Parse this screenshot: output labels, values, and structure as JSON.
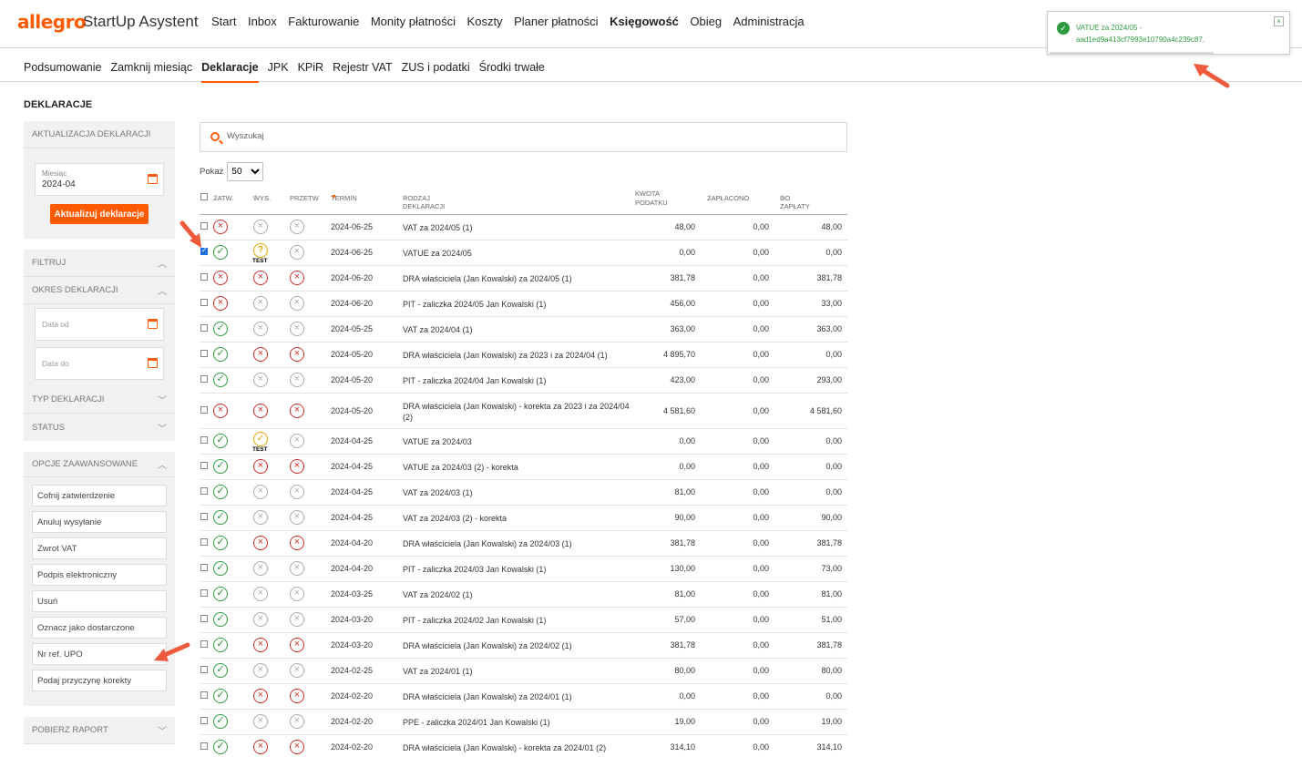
{
  "app": {
    "logo": "allegro",
    "name": "StartUp Asystent"
  },
  "topnav": [
    "Start",
    "Inbox",
    "Fakturowanie",
    "Monity płatności",
    "Koszty",
    "Planer płatności",
    "Księgowość",
    "Obieg",
    "Administracja"
  ],
  "topnav_active": "Księgowość",
  "subnav": [
    "Podsumowanie",
    "Zamknij miesiąc",
    "Deklaracje",
    "JPK",
    "KPiR",
    "Rejestr VAT",
    "ZUS i podatki",
    "Środki trwałe"
  ],
  "subnav_active": "Deklaracje",
  "page_title": "DEKLARACJE",
  "sidebar": {
    "update_panel": {
      "title": "AKTUALIZACJA DEKLARACJI",
      "month_label": "Miesiąc",
      "month_value": "2024-04",
      "button": "Aktualizuj deklaracje"
    },
    "filter": {
      "title": "FILTRUJ",
      "period_title": "OKRES DEKLARACJI",
      "date_from_placeholder": "Data od",
      "date_to_placeholder": "Data do",
      "type_title": "TYP DEKLARACJI",
      "status_title": "STATUS"
    },
    "advanced": {
      "title": "OPCJE ZAAWANSOWANE",
      "options": [
        "Cofnij zatwierdzenie",
        "Anuluj wysyłanie",
        "Zwrot VAT",
        "Podpis elektroniczny",
        "Usuń",
        "Oznacz jako dostarczone",
        "Nr ref. UPO",
        "Podaj przyczynę korekty"
      ]
    },
    "report": {
      "title": "POBIERZ RAPORT"
    }
  },
  "search": {
    "placeholder": "Wyszukaj"
  },
  "show": {
    "label": "Pokaż",
    "value": "50"
  },
  "table": {
    "headers": {
      "zatw": "ZATW.",
      "wys": "WYS.",
      "przetw": "PRZETW",
      "termin": "TERMIN",
      "rodzaj": "RODZAJ DEKLARACJI",
      "kwota": "KWOTA PODATKU",
      "zaplacono": "ZAPŁACONO",
      "do_zaplaty": "DO ZAPŁATY"
    },
    "test_label": "TEST",
    "rows": [
      {
        "checked": false,
        "zatw": "err",
        "wys": "na",
        "przetw": "na",
        "termin": "2024-06-25",
        "rodzaj": "VAT za 2024/05 (1)",
        "kwota": "48,00",
        "zaplacono": "0,00",
        "do_zaplaty": "48,00"
      },
      {
        "checked": true,
        "zatw": "ok",
        "wys": "test",
        "przetw": "na",
        "termin": "2024-06-25",
        "rodzaj": "VATUE za 2024/05",
        "kwota": "0,00",
        "zaplacono": "0,00",
        "do_zaplaty": "0,00"
      },
      {
        "checked": false,
        "zatw": "err",
        "wys": "err",
        "przetw": "err",
        "termin": "2024-06-20",
        "rodzaj": "DRA właściciela (Jan Kowalski) za 2024/05 (1)",
        "kwota": "381,78",
        "zaplacono": "0,00",
        "do_zaplaty": "381,78"
      },
      {
        "checked": false,
        "zatw": "err",
        "wys": "na",
        "przetw": "na",
        "termin": "2024-06-20",
        "rodzaj": "PIT - zaliczka 2024/05 Jan Kowalski (1)",
        "kwota": "456,00",
        "zaplacono": "0,00",
        "do_zaplaty": "33,00"
      },
      {
        "checked": false,
        "zatw": "ok",
        "wys": "na",
        "przetw": "na",
        "termin": "2024-05-25",
        "rodzaj": "VAT za 2024/04 (1)",
        "kwota": "363,00",
        "zaplacono": "0,00",
        "do_zaplaty": "363,00"
      },
      {
        "checked": false,
        "zatw": "ok",
        "wys": "err",
        "przetw": "err",
        "termin": "2024-05-20",
        "rodzaj": "DRA właściciela (Jan Kowalski) za 2023 i za 2024/04 (1)",
        "kwota": "4 895,70",
        "zaplacono": "0,00",
        "do_zaplaty": "0,00"
      },
      {
        "checked": false,
        "zatw": "ok",
        "wys": "na",
        "przetw": "na",
        "termin": "2024-05-20",
        "rodzaj": "PIT - zaliczka 2024/04 Jan Kowalski (1)",
        "kwota": "423,00",
        "zaplacono": "0,00",
        "do_zaplaty": "293,00"
      },
      {
        "checked": false,
        "zatw": "err",
        "wys": "err",
        "przetw": "err",
        "termin": "2024-05-20",
        "rodzaj": "DRA właściciela (Jan Kowalski) - korekta za 2023 i za 2024/04 (2)",
        "kwota": "4 581,60",
        "zaplacono": "0,00",
        "do_zaplaty": "4 581,60",
        "tall": true
      },
      {
        "checked": false,
        "zatw": "ok",
        "wys": "testok",
        "przetw": "na",
        "termin": "2024-04-25",
        "rodzaj": "VATUE za 2024/03",
        "kwota": "0,00",
        "zaplacono": "0,00",
        "do_zaplaty": "0,00"
      },
      {
        "checked": false,
        "zatw": "ok",
        "wys": "err",
        "przetw": "err",
        "termin": "2024-04-25",
        "rodzaj": "VATUE za 2024/03 (2) - korekta",
        "kwota": "0,00",
        "zaplacono": "0,00",
        "do_zaplaty": "0,00"
      },
      {
        "checked": false,
        "zatw": "ok",
        "wys": "na",
        "przetw": "na",
        "termin": "2024-04-25",
        "rodzaj": "VAT za 2024/03 (1)",
        "kwota": "81,00",
        "zaplacono": "0,00",
        "do_zaplaty": "0,00"
      },
      {
        "checked": false,
        "zatw": "ok",
        "wys": "na",
        "przetw": "na",
        "termin": "2024-04-25",
        "rodzaj": "VAT za 2024/03 (2) - korekta",
        "kwota": "90,00",
        "zaplacono": "0,00",
        "do_zaplaty": "90,00"
      },
      {
        "checked": false,
        "zatw": "ok",
        "wys": "err",
        "przetw": "err",
        "termin": "2024-04-20",
        "rodzaj": "DRA właściciela (Jan Kowalski) za 2024/03 (1)",
        "kwota": "381,78",
        "zaplacono": "0,00",
        "do_zaplaty": "381,78"
      },
      {
        "checked": false,
        "zatw": "ok",
        "wys": "na",
        "przetw": "na",
        "termin": "2024-04-20",
        "rodzaj": "PIT - zaliczka 2024/03 Jan Kowalski (1)",
        "kwota": "130,00",
        "zaplacono": "0,00",
        "do_zaplaty": "73,00"
      },
      {
        "checked": false,
        "zatw": "ok",
        "wys": "na",
        "przetw": "na",
        "termin": "2024-03-25",
        "rodzaj": "VAT za 2024/02 (1)",
        "kwota": "81,00",
        "zaplacono": "0,00",
        "do_zaplaty": "81,00"
      },
      {
        "checked": false,
        "zatw": "ok",
        "wys": "na",
        "przetw": "na",
        "termin": "2024-03-20",
        "rodzaj": "PIT - zaliczka 2024/02 Jan Kowalski (1)",
        "kwota": "57,00",
        "zaplacono": "0,00",
        "do_zaplaty": "51,00"
      },
      {
        "checked": false,
        "zatw": "ok",
        "wys": "err",
        "przetw": "err",
        "termin": "2024-03-20",
        "rodzaj": "DRA właściciela (Jan Kowalski) za 2024/02 (1)",
        "kwota": "381,78",
        "zaplacono": "0,00",
        "do_zaplaty": "381,78"
      },
      {
        "checked": false,
        "zatw": "ok",
        "wys": "na",
        "przetw": "na",
        "termin": "2024-02-25",
        "rodzaj": "VAT za 2024/01 (1)",
        "kwota": "80,00",
        "zaplacono": "0,00",
        "do_zaplaty": "80,00"
      },
      {
        "checked": false,
        "zatw": "ok",
        "wys": "err",
        "przetw": "err",
        "termin": "2024-02-20",
        "rodzaj": "DRA właściciela (Jan Kowalski) za 2024/01 (1)",
        "kwota": "0,00",
        "zaplacono": "0,00",
        "do_zaplaty": "0,00"
      },
      {
        "checked": false,
        "zatw": "ok",
        "wys": "na",
        "przetw": "na",
        "termin": "2024-02-20",
        "rodzaj": "PPE - zaliczka 2024/01 Jan Kowalski (1)",
        "kwota": "19,00",
        "zaplacono": "0,00",
        "do_zaplaty": "19,00"
      },
      {
        "checked": false,
        "zatw": "ok",
        "wys": "err",
        "przetw": "err",
        "termin": "2024-02-20",
        "rodzaj": "DRA właściciela (Jan Kowalski) - korekta za 2024/01 (2)",
        "kwota": "314,10",
        "zaplacono": "0,00",
        "do_zaplaty": "314,10"
      }
    ]
  },
  "toast": {
    "line1": "VATUE za 2024/05 -",
    "line2": "aad1ed9a413cf7993e10790a4c239c87."
  },
  "colors": {
    "accent": "#ff5a00",
    "ok": "#2e9b40",
    "error": "#d62b2b",
    "neutral": "#aaaaaa",
    "test": "#e0a800",
    "arrow": "#ef5a3c"
  },
  "icons": {
    "ok": "check-circle-icon",
    "err": "x-circle-red-icon",
    "na": "x-circle-grey-icon",
    "test": "question-circle-test-icon"
  }
}
